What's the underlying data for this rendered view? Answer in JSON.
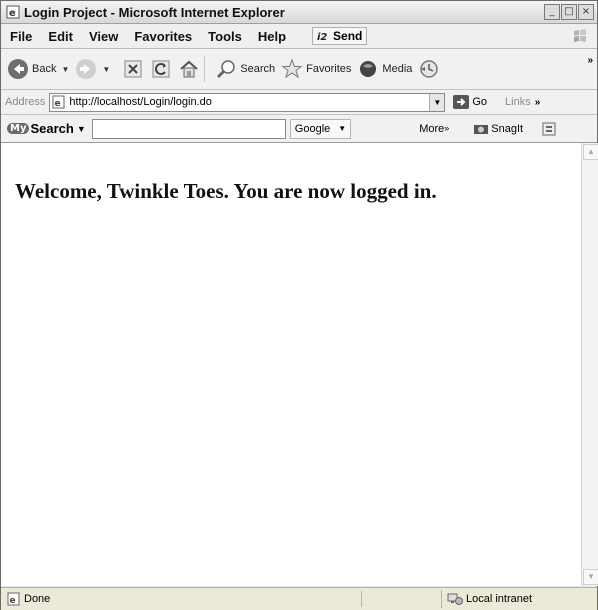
{
  "window": {
    "title": "Login Project - Microsoft Internet Explorer",
    "controls": [
      "minimize",
      "maximize",
      "close"
    ]
  },
  "menu": {
    "items": [
      "File",
      "Edit",
      "View",
      "Favorites",
      "Tools",
      "Help"
    ],
    "send_label": "Send"
  },
  "toolbar": {
    "back_label": "Back",
    "search_label": "Search",
    "favorites_label": "Favorites",
    "media_label": "Media"
  },
  "address": {
    "label": "Address",
    "url": "http://localhost/Login/login.do",
    "go_label": "Go",
    "links_label": "Links"
  },
  "searchbar": {
    "mysearch_label": "Search",
    "mysearch_logo": "My",
    "search_value": "",
    "engine": "Google",
    "more_label": "More",
    "snagit_label": "SnagIt"
  },
  "content": {
    "message": "Welcome, Twinkle Toes. You are now logged in."
  },
  "status": {
    "text": "Done",
    "zone": "Local intranet"
  },
  "colors": {
    "chrome": "#ece9d8",
    "toolbar_bg": "#f1f1f1",
    "go_green": "#3c9a3c"
  }
}
